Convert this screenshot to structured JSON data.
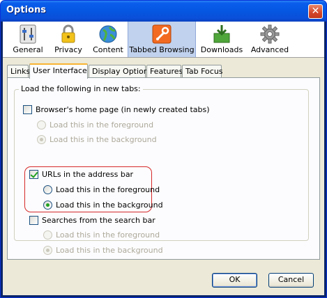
{
  "window": {
    "title": "Options",
    "close_glyph": "✕"
  },
  "panes": [
    {
      "label": "General",
      "icon": "sliders-icon"
    },
    {
      "label": "Privacy",
      "icon": "lock-icon"
    },
    {
      "label": "Content",
      "icon": "globe-icon"
    },
    {
      "label": "Tabbed Browsing",
      "icon": "wrench-icon",
      "active": true
    },
    {
      "label": "Downloads",
      "icon": "download-box-icon"
    },
    {
      "label": "Advanced",
      "icon": "gear-icon"
    }
  ],
  "tabs": [
    {
      "label": "Links"
    },
    {
      "label": "User Interface",
      "active": true
    },
    {
      "label": "Display Options"
    },
    {
      "label": "Features"
    },
    {
      "label": "Tab Focus"
    }
  ],
  "group": {
    "legend": "Load the following in new tabs:",
    "sections": [
      {
        "label": "Browser's home page (in newly created tabs)",
        "checked": false,
        "options": [
          {
            "label": "Load this in the foreground",
            "selected": false,
            "disabled": true
          },
          {
            "label": "Load this in the background",
            "selected": true,
            "disabled": true
          }
        ]
      },
      {
        "label": "URLs in the address bar",
        "checked": true,
        "highlighted": true,
        "options": [
          {
            "label": "Load this in the foreground",
            "selected": false,
            "disabled": false
          },
          {
            "label": "Load this in the background",
            "selected": true,
            "disabled": false
          }
        ]
      },
      {
        "label": "Searches from the search bar",
        "checked": false,
        "options": [
          {
            "label": "Load this in the foreground",
            "selected": false,
            "disabled": true
          },
          {
            "label": "Load this in the background",
            "selected": true,
            "disabled": true
          }
        ]
      }
    ]
  },
  "buttons": {
    "ok": "OK",
    "cancel": "Cancel"
  },
  "colors": {
    "title_bar": "#0558e3",
    "active_tab_accent": "#f8b331",
    "highlight_outline": "#d62828",
    "check_green": "#21a121"
  }
}
